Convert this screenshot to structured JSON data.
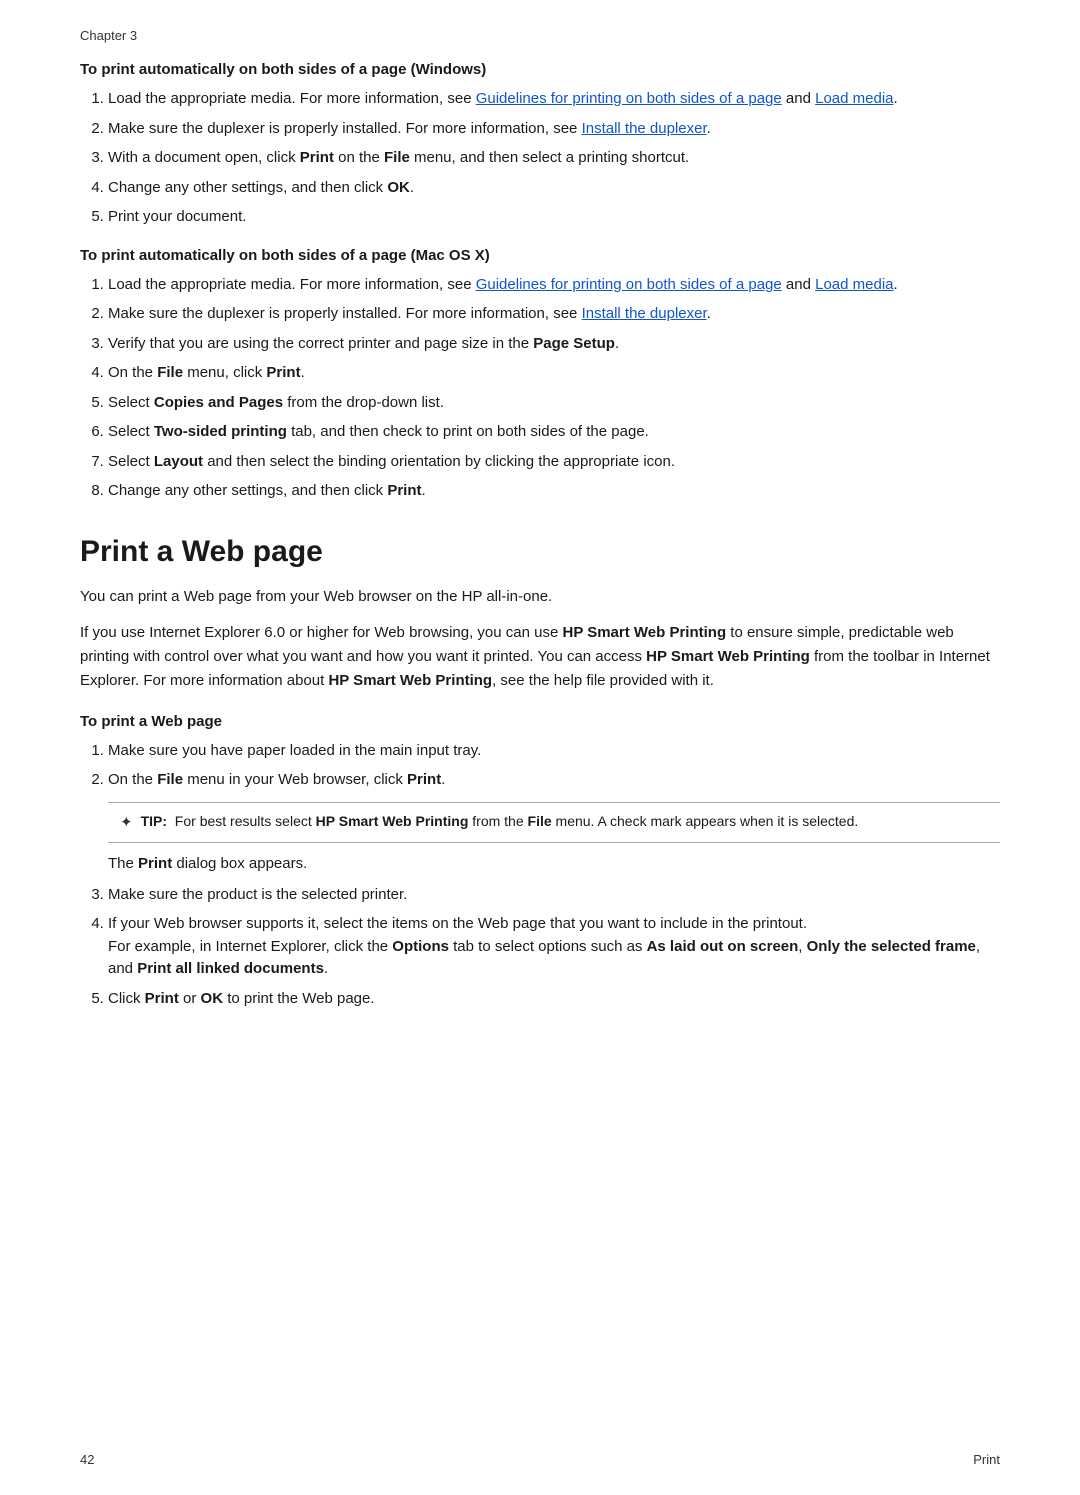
{
  "chapter": {
    "label": "Chapter 3"
  },
  "section_windows": {
    "heading": "To print automatically on both sides of a page (Windows)",
    "steps": [
      {
        "id": 1,
        "text_before": "Load the appropriate media. For more information, see ",
        "link1_text": "Guidelines for printing on both sides of a page",
        "text_between": " and ",
        "link2_text": "Load media",
        "text_after": "."
      },
      {
        "id": 2,
        "text_before": "Make sure the duplexer is properly installed. For more information, see ",
        "link1_text": "Install the duplexer",
        "text_after": "."
      },
      {
        "id": 3,
        "text": "With a document open, click Print on the File menu, and then select a printing shortcut."
      },
      {
        "id": 4,
        "text": "Change any other settings, and then click OK."
      },
      {
        "id": 5,
        "text": "Print your document."
      }
    ]
  },
  "section_mac": {
    "heading": "To print automatically on both sides of a page (Mac OS X)",
    "steps": [
      {
        "id": 1,
        "text_before": "Load the appropriate media. For more information, see ",
        "link1_text": "Guidelines for printing on both sides of a page",
        "text_between": " and ",
        "link2_text": "Load media",
        "text_after": "."
      },
      {
        "id": 2,
        "text_before": "Make sure the duplexer is properly installed. For more information, see ",
        "link1_text": "Install the duplexer",
        "text_after": "."
      },
      {
        "id": 3,
        "text": "Verify that you are using the correct printer and page size in the Page Setup."
      },
      {
        "id": 4,
        "text": "On the File menu, click Print."
      },
      {
        "id": 5,
        "text": "Select Copies and Pages from the drop-down list."
      },
      {
        "id": 6,
        "text": "Select Two-sided printing tab, and then check to print on both sides of the page."
      },
      {
        "id": 7,
        "text": "Select Layout and then select the binding orientation by clicking the appropriate icon."
      },
      {
        "id": 8,
        "text": "Change any other settings, and then click Print."
      }
    ]
  },
  "print_web_section": {
    "heading": "Print a Web page",
    "para1": "You can print a Web page from your Web browser on the HP all-in-one.",
    "para2_before": "If you use Internet Explorer 6.0 or higher for Web browsing, you can use ",
    "para2_bold1": "HP Smart Web Printing",
    "para2_mid1": " to ensure simple, predictable web printing with control over what you want and how you want it printed. You can access ",
    "para2_bold2": "HP Smart Web Printing",
    "para2_mid2": " from the toolbar in Internet Explorer. For more information about ",
    "para2_bold3": "HP Smart Web Printing",
    "para2_end": ", see the help file provided with it.",
    "sub_heading": "To print a Web page",
    "steps": [
      {
        "id": 1,
        "text": "Make sure you have paper loaded in the main input tray."
      },
      {
        "id": 2,
        "text_before": "On the ",
        "bold1": "File",
        "text_mid": " menu in your Web browser, click ",
        "bold2": "Print",
        "text_after": "."
      }
    ],
    "tip": {
      "icon": "✦",
      "label": "TIP:",
      "text_before": "  For best results select ",
      "bold1": "HP Smart Web Printing",
      "text_mid": " from the ",
      "bold2": "File",
      "text_end": " menu. A check mark appears when it is selected."
    },
    "print_dialog": {
      "text_before": "The ",
      "bold": "Print",
      "text_after": " dialog box appears."
    },
    "steps_cont": [
      {
        "id": 3,
        "text": "Make sure the product is the selected printer."
      },
      {
        "id": 4,
        "text_before": "If your Web browser supports it, select the items on the Web page that you want to include in the printout.",
        "extra_text_before": "For example, in Internet Explorer, click the ",
        "extra_bold1": "Options",
        "extra_text_mid": " tab to select options such as ",
        "extra_bold2": "As laid out on screen",
        "extra_text_mid2": ", ",
        "extra_bold3": "Only the selected frame",
        "extra_text_mid3": ", and ",
        "extra_bold4": "Print all linked documents",
        "extra_text_end": "."
      },
      {
        "id": 5,
        "text_before": "Click ",
        "bold1": "Print",
        "text_mid": " or ",
        "bold2": "OK",
        "text_after": " to print the Web page."
      }
    ]
  },
  "footer": {
    "page_number": "42",
    "section_label": "Print"
  }
}
